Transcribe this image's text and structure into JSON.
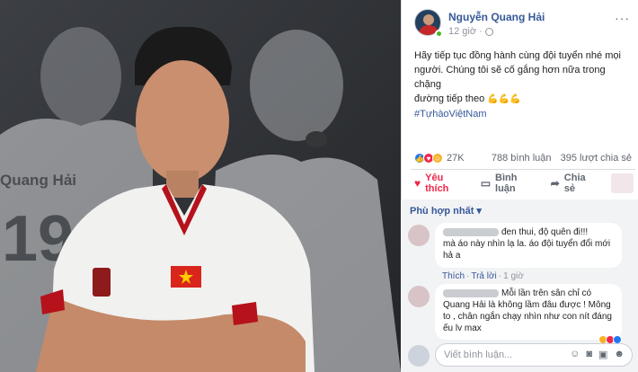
{
  "post": {
    "author": "Nguyễn Quang Hải",
    "time": "12 giờ",
    "more": "···",
    "text_lines": [
      "Hãy tiếp tục đồng hành cùng đội tuyển nhé mọi",
      "người. Chúng tôi sẽ cố gắng hơn nữa trong chặng",
      "đường tiếp theo"
    ],
    "emoji": "💪💪💪",
    "hashtag": "#TựhàoViệtNam"
  },
  "photo": {
    "name": "Quang Hải",
    "shirt_number": "19"
  },
  "reactions": {
    "icons": [
      "like-icon",
      "love-icon",
      "haha-icon"
    ],
    "count": "27K",
    "comments": "788 bình luận",
    "shares": "395 lượt chia sẻ"
  },
  "actions": {
    "like": "Yêu thích",
    "comment": "Bình luận",
    "share": "Chia sẻ"
  },
  "comments": {
    "sort_label": "Phù hợp nhất ▾",
    "items": [
      {
        "text_head": "đen thui, độ quên đi!!!",
        "text_rest": "mà áo này nhìn lạ la. áo đội tuyển đổi mới hả a",
        "like": "Thích",
        "reply": "Trả lời",
        "time": "1 giờ"
      },
      {
        "text_head": "Mỗi lần trên sân chỉ có",
        "text_rest": "Quang Hải là không lầm đâu được ! Mông to , chân ngắn chạy nhìn như con nít đáng ếu lv max"
      }
    ]
  },
  "composer": {
    "placeholder": "Viết bình luận...",
    "icons": [
      "emoji-icon",
      "camera-icon",
      "gif-icon",
      "sticker-icon"
    ]
  },
  "colors": {
    "link_blue": "#365899",
    "love_red": "#f0284a",
    "like_blue": "#2078f4",
    "haha_yellow": "#f7b125"
  }
}
